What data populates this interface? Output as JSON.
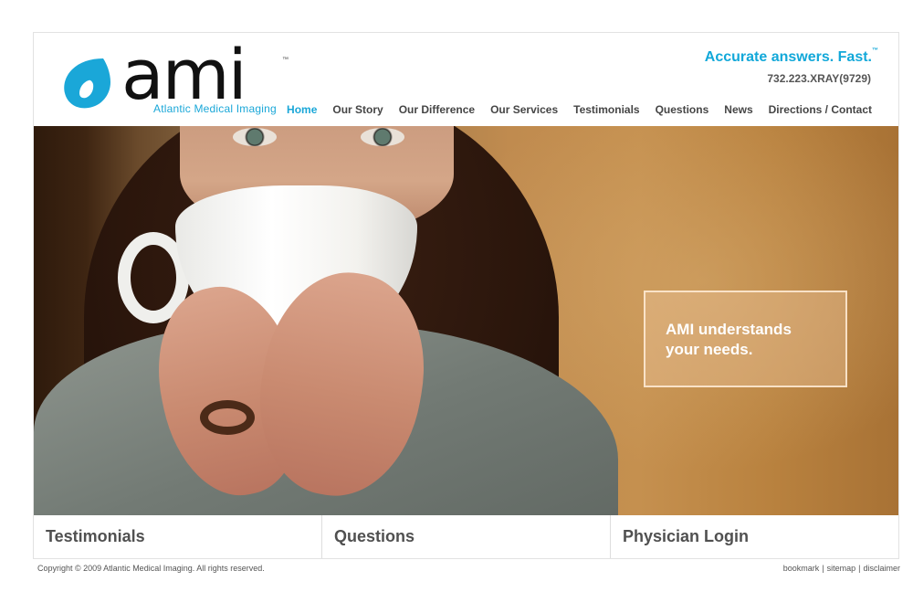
{
  "header": {
    "logo_text": "ami",
    "logo_subtitle": "Atlantic Medical Imaging",
    "logo_tm": "™",
    "tagline": "Accurate answers. Fast.",
    "tagline_tm": "™",
    "phone": "732.223.XRAY(9729)"
  },
  "nav": {
    "items": [
      {
        "label": "Home",
        "active": true
      },
      {
        "label": "Our Story"
      },
      {
        "label": "Our Difference"
      },
      {
        "label": "Our Services"
      },
      {
        "label": "Testimonials"
      },
      {
        "label": "Questions"
      },
      {
        "label": "News"
      },
      {
        "label": "Directions / Contact"
      }
    ]
  },
  "hero": {
    "promo_text": "AMI understands your needs."
  },
  "boxes": [
    {
      "label": "Testimonials"
    },
    {
      "label": "Questions"
    },
    {
      "label": "Physician Login"
    }
  ],
  "footer": {
    "copyright": "Copyright © 2009 Atlantic Medical Imaging. All rights reserved.",
    "links": [
      "bookmark",
      "sitemap",
      "disclaimer"
    ],
    "separator": "|"
  },
  "colors": {
    "accent": "#1aa7d8",
    "nav_text": "#454545",
    "promo_text": "#ffffff"
  },
  "icons": {
    "logo_mark": "ami-drop-logo-icon"
  }
}
